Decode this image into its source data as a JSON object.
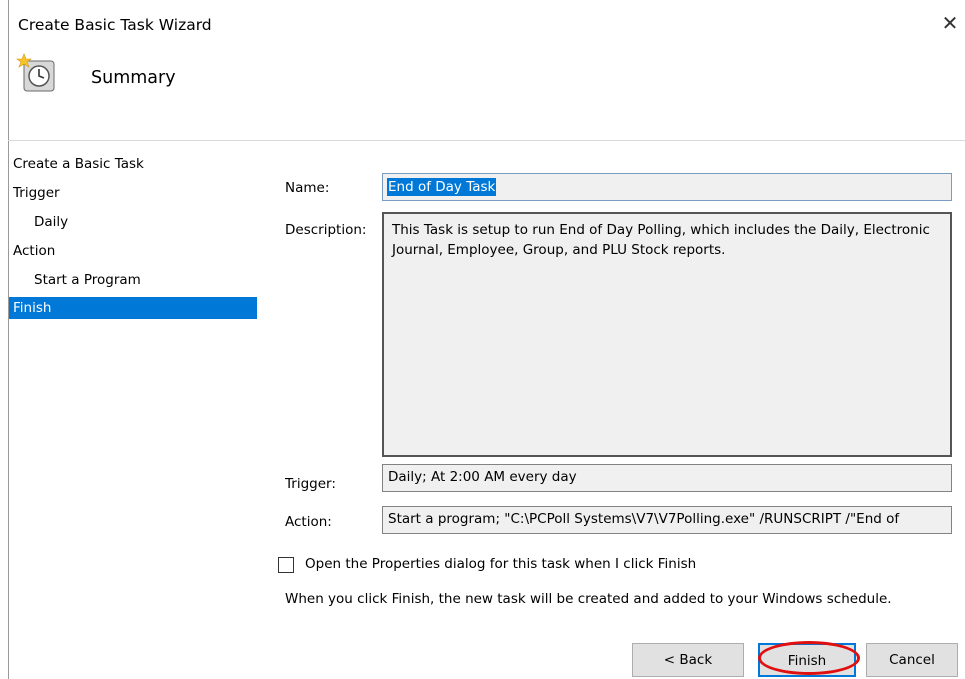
{
  "window": {
    "title": "Create Basic Task Wizard",
    "close_glyph": "✕"
  },
  "header": {
    "title": "Summary",
    "icon": "task-clock-icon"
  },
  "nav": {
    "items": [
      {
        "label": "Create a Basic Task",
        "level": 0,
        "selected": false
      },
      {
        "label": "Trigger",
        "level": 0,
        "selected": false
      },
      {
        "label": "Daily",
        "level": 1,
        "selected": false
      },
      {
        "label": "Action",
        "level": 0,
        "selected": false
      },
      {
        "label": "Start a Program",
        "level": 1,
        "selected": false
      },
      {
        "label": "Finish",
        "level": 0,
        "selected": true
      }
    ]
  },
  "form": {
    "name_label": "Name:",
    "name_value": "End of Day Task",
    "description_label": "Description:",
    "description_value": "This Task is setup to run End of Day Polling, which includes the Daily, Electronic Journal, Employee, Group, and PLU Stock reports.",
    "trigger_label": "Trigger:",
    "trigger_value": "Daily; At 2:00 AM every day",
    "action_label": "Action:",
    "action_value": "Start a program; \"C:\\PCPoll Systems\\V7\\V7Polling.exe\" /RUNSCRIPT /\"End of"
  },
  "options": {
    "open_properties_label": "Open the Properties dialog for this task when I click Finish",
    "open_properties_checked": false,
    "info_text": "When you click Finish, the new task will be created and added to your Windows schedule."
  },
  "buttons": {
    "back": "< Back",
    "finish": "Finish",
    "cancel": "Cancel"
  },
  "colors": {
    "selection": "#0078d7",
    "highlight_circle": "#e01010"
  }
}
